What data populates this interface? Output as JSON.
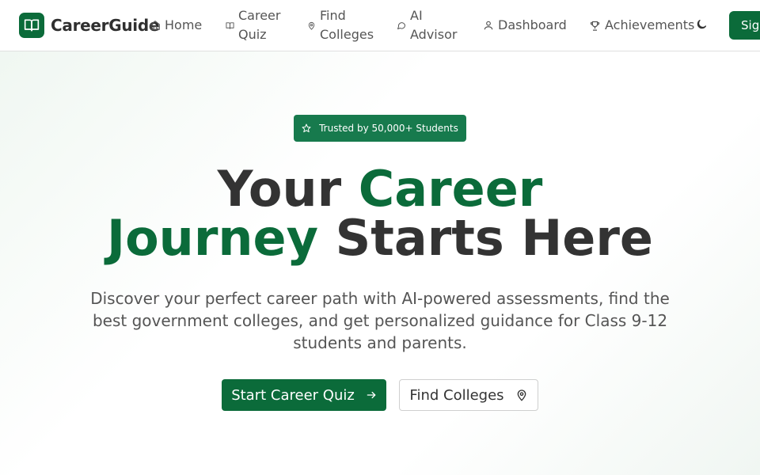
{
  "brand": {
    "name": "CareerGuide",
    "icon": "open-book-icon",
    "color": "#0b6b3a"
  },
  "nav": {
    "items": [
      {
        "label": "Home",
        "icon": "home-icon"
      },
      {
        "label": "Career Quiz",
        "icon": "book-icon"
      },
      {
        "label": "Find Colleges",
        "icon": "map-pin-icon"
      },
      {
        "label": "AI Advisor",
        "icon": "chat-bubble-icon"
      },
      {
        "label": "Dashboard",
        "icon": "user-icon"
      },
      {
        "label": "Achievements",
        "icon": "trophy-icon"
      }
    ],
    "theme_icon": "moon-icon",
    "signin_label": "Sign In"
  },
  "hero": {
    "badge": "Trusted by 50,000+ Students",
    "badge_icon": "star-icon",
    "title_part1": "Your ",
    "title_highlight1": "Career",
    "title_highlight2": "Journey",
    "title_part2": " Starts Here",
    "subtitle": "Discover your perfect career path with AI-powered assessments, find the best government colleges, and get personalized guidance for Class 9-12 students and parents.",
    "primary_cta": "Start Career Quiz",
    "primary_cta_icon": "arrow-right-icon",
    "secondary_cta": "Find Colleges",
    "secondary_cta_icon": "map-pin-icon"
  },
  "colors": {
    "accent": "#0b6b3a",
    "badge_bg": "#177a4d",
    "text": "#333333"
  }
}
